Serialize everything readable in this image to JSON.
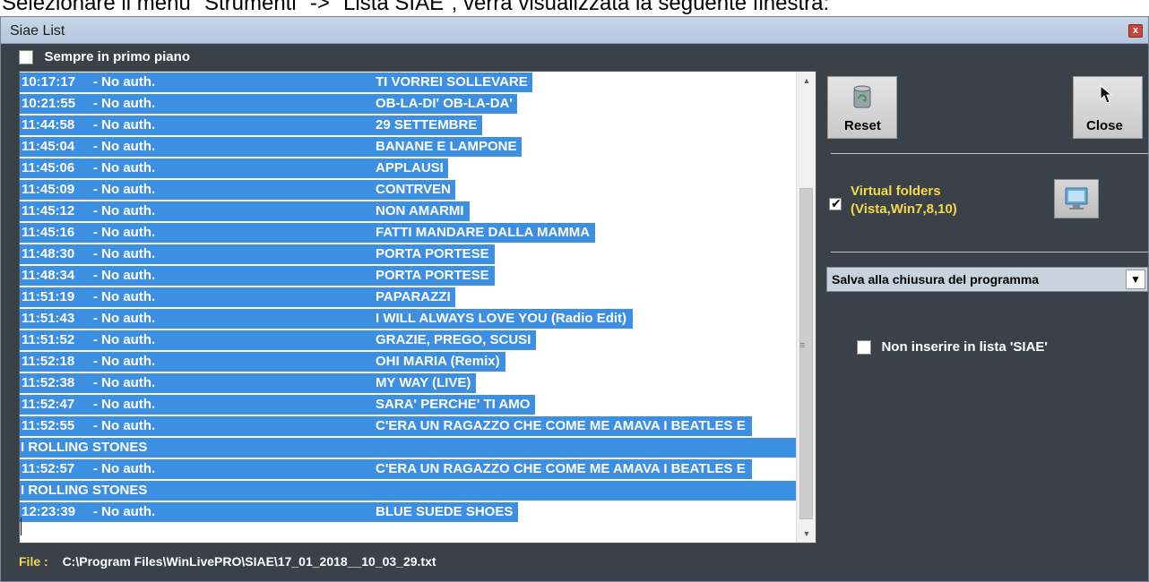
{
  "document_caption": "Selezionare il menu \"Strumenti\" -> \"Lista SIAE\", verrà visualizzata la seguente finestra:",
  "window": {
    "title": "Siae List",
    "close_glyph": "x"
  },
  "top_option": {
    "label": "Sempre in primo piano",
    "checked": false
  },
  "entries": [
    {
      "time": "10:17:17",
      "author": "- No auth.",
      "title": "TI VORREI SOLLEVARE"
    },
    {
      "time": "10:21:55",
      "author": "- No auth.",
      "title": "OB-LA-DI' OB-LA-DA'"
    },
    {
      "time": "11:44:58",
      "author": "- No auth.",
      "title": "29 SETTEMBRE"
    },
    {
      "time": "11:45:04",
      "author": "- No auth.",
      "title": "BANANE E LAMPONE"
    },
    {
      "time": "11:45:06",
      "author": "- No auth.",
      "title": "APPLAUSI"
    },
    {
      "time": "11:45:09",
      "author": "- No auth.",
      "title": "CONTRVEN"
    },
    {
      "time": "11:45:12",
      "author": "- No auth.",
      "title": "NON AMARMI"
    },
    {
      "time": "11:45:16",
      "author": "- No auth.",
      "title": "FATTI MANDARE DALLA MAMMA"
    },
    {
      "time": "11:48:30",
      "author": "- No auth.",
      "title": "PORTA PORTESE"
    },
    {
      "time": "11:48:34",
      "author": "- No auth.",
      "title": "PORTA PORTESE"
    },
    {
      "time": "11:51:19",
      "author": "- No auth.",
      "title": "PAPARAZZI"
    },
    {
      "time": "11:51:43",
      "author": "- No auth.",
      "title": "I WILL ALWAYS LOVE YOU (Radio Edit)"
    },
    {
      "time": "11:51:52",
      "author": "- No auth.",
      "title": "GRAZIE, PREGO, SCUSI"
    },
    {
      "time": "11:52:18",
      "author": "- No auth.",
      "title": "OHI MARIA (Remix)"
    },
    {
      "time": "11:52:38",
      "author": "- No auth.",
      "title": "MY WAY (LIVE)"
    },
    {
      "time": "11:52:47",
      "author": "- No auth.",
      "title": "SARA' PERCHE' TI AMO"
    },
    {
      "time": "11:52:55",
      "author": "- No auth.",
      "title": "C'ERA UN RAGAZZO CHE COME ME AMAVA I BEATLES E",
      "continuation": "I ROLLING STONES"
    },
    {
      "time": "11:52:57",
      "author": "- No auth.",
      "title": "C'ERA UN RAGAZZO CHE COME ME AMAVA I BEATLES E",
      "continuation": "I ROLLING STONES"
    },
    {
      "time": "12:23:39",
      "author": "- No auth.",
      "title": "BLUE SUEDE SHOES"
    }
  ],
  "buttons": {
    "reset": {
      "label": "Reset",
      "icon": "recycle-bin-icon"
    },
    "close": {
      "label": "Close",
      "icon": "exit-cursor-icon"
    }
  },
  "virtual_folders": {
    "label_line1": "Virtual folders",
    "label_line2": "(Vista,Win7,8,10)",
    "checked": true,
    "icon": "monitor-icon"
  },
  "save_mode": {
    "selected": "Salva alla chiusura del programma"
  },
  "exclude_option": {
    "label": "Non inserire in lista 'SIAE'",
    "checked": false
  },
  "file": {
    "label": "File :",
    "path": "C:\\Program Files\\WinLivePRO\\SIAE\\17_01_2018__10_03_29.txt"
  },
  "colors": {
    "window_bg": "#3b4148",
    "selection": "#3d8fe1",
    "accent_yellow": "#f2d84b"
  }
}
